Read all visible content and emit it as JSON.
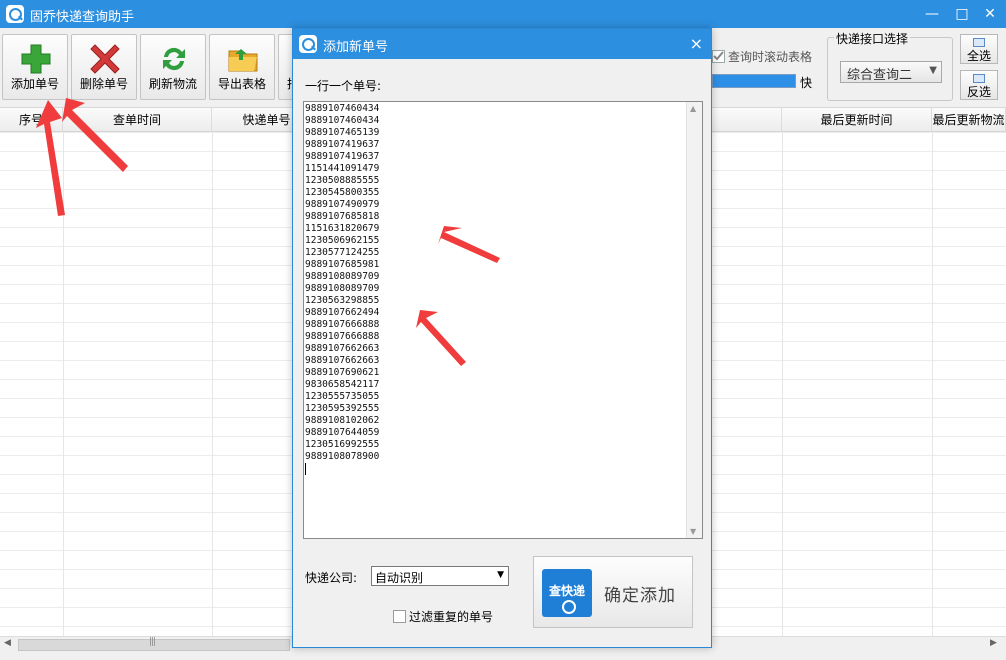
{
  "window": {
    "title": "固乔快递查询助手",
    "controls": {
      "minimize": "—",
      "maximize": "□",
      "close": "✕"
    }
  },
  "toolbar": {
    "buttons": [
      {
        "label": "添加单号",
        "icon": "plus-icon",
        "color": "#3aa63a"
      },
      {
        "label": "删除单号",
        "icon": "delete-x-icon",
        "color": "#d23a3a"
      },
      {
        "label": "刷新物流",
        "icon": "refresh-icon",
        "color": "#2e9e3e"
      },
      {
        "label": "导出表格",
        "icon": "folder-icon",
        "color": "#e8a92a"
      },
      {
        "label": "拍"
      }
    ],
    "scroll_check_label": "查询时滚动表格",
    "speed_label": "快",
    "api_group_title": "快递接口选择",
    "api_selected": "综合查询二",
    "select_all": "全选",
    "invert_select": "反选"
  },
  "table": {
    "columns": [
      "序号",
      "查单时间",
      "快递单号",
      "",
      "",
      "最后更新时间",
      "最后更新物流"
    ]
  },
  "dialog": {
    "title": "添加新单号",
    "close": "×",
    "hint": "一行一个单号:",
    "tracking_numbers": [
      "9889107460434",
      "9889107460434",
      "9889107465139",
      "9889107419637",
      "9889107419637",
      "1151441091479",
      "1230508885555",
      "1230545800355",
      "9889107490979",
      "9889107685818",
      "1151631820679",
      "1230506962155",
      "1230577124255",
      "9889107685981",
      "9889108089709",
      "9889108089709",
      "1230563298855",
      "9889107662494",
      "9889107666888",
      "9889107666888",
      "9889107662663",
      "9889107662663",
      "9889107690621",
      "9830658542117",
      "1230555735055",
      "1230595392555",
      "9889108102062",
      "9889107644059",
      "1230516992555",
      "9889108078900"
    ],
    "company_label": "快递公司:",
    "company_value": "自动识别",
    "filter_label": "过滤重复的单号",
    "confirm_logo": "查快递",
    "confirm_label": "确定添加"
  },
  "colors": {
    "accent": "#2d8fe0",
    "arrow": "#f03c3c"
  }
}
